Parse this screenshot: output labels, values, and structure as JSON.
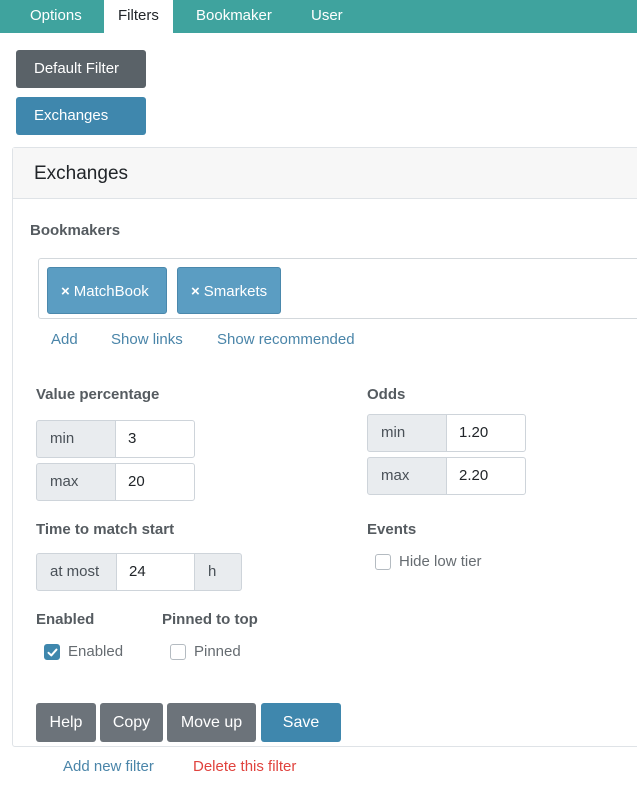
{
  "nav": {
    "tabs": [
      {
        "label": "Options",
        "active": false
      },
      {
        "label": "Filters",
        "active": true
      },
      {
        "label": "Bookmaker",
        "active": false
      },
      {
        "label": "User",
        "active": false
      }
    ]
  },
  "filters": {
    "items": [
      {
        "label": "Default Filter"
      },
      {
        "label": "Exchanges"
      }
    ]
  },
  "card": {
    "title": "Exchanges",
    "bookmakers": {
      "label": "Bookmakers",
      "tags": [
        {
          "remove": "×",
          "label": "MatchBook"
        },
        {
          "remove": "×",
          "label": "Smarkets"
        }
      ],
      "links": {
        "add": "Add",
        "show_links": "Show links",
        "show_recommended": "Show recommended"
      }
    },
    "value_percentage": {
      "label": "Value percentage",
      "min_label": "min",
      "min_value": "3",
      "max_label": "max",
      "max_value": "20"
    },
    "odds": {
      "label": "Odds",
      "min_label": "min",
      "min_value": "1.20",
      "max_label": "max",
      "max_value": "2.20"
    },
    "time_to_match": {
      "label": "Time to match start",
      "prefix": "at most",
      "value": "24",
      "suffix": "h"
    },
    "events": {
      "label": "Events",
      "hide_low_tier_label": "Hide low tier",
      "hide_low_tier_checked": false
    },
    "enabled": {
      "label": "Enabled",
      "checkbox_label": "Enabled",
      "checked": true
    },
    "pinned": {
      "label": "Pinned to top",
      "checkbox_label": "Pinned",
      "checked": false
    },
    "actions": {
      "help": "Help",
      "copy": "Copy",
      "move_up": "Move up",
      "save": "Save"
    }
  },
  "footer": {
    "add_new_filter": "Add new filter",
    "delete_this_filter": "Delete this filter"
  },
  "colors": {
    "nav_bg": "#3fa39e",
    "primary": "#3f87ad",
    "secondary": "#6c737a",
    "danger": "#e0433e",
    "link": "#4a85a9"
  }
}
